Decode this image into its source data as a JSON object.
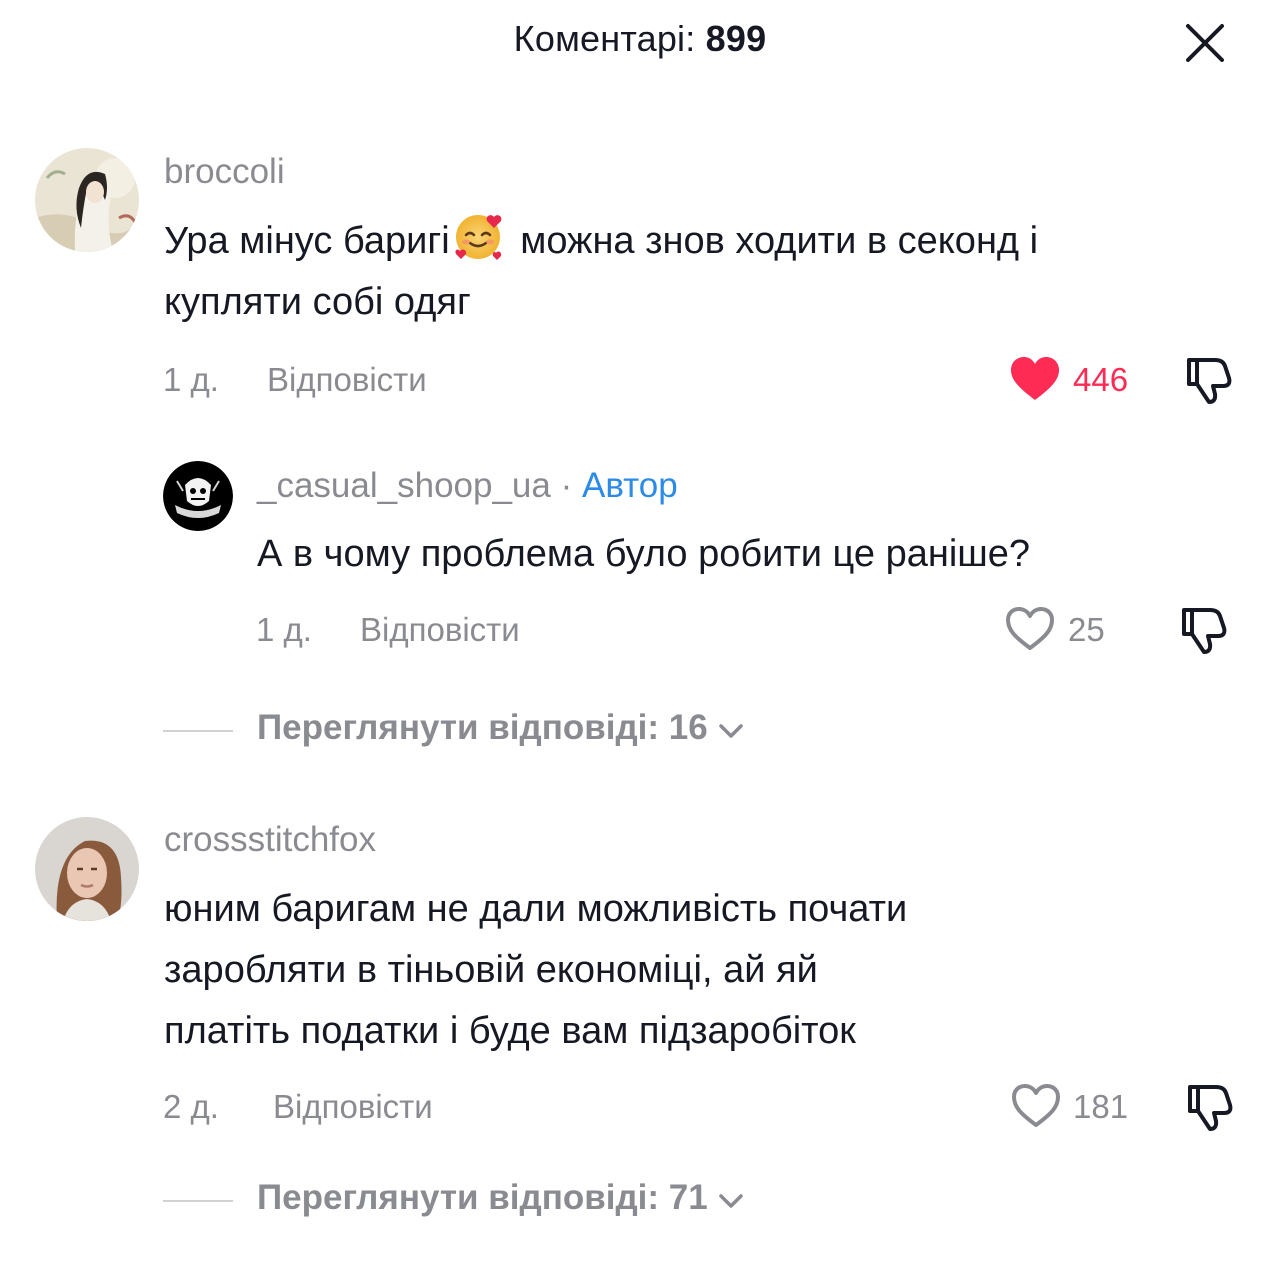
{
  "header": {
    "title_prefix": "Коментарі:",
    "count": "899"
  },
  "comments": [
    {
      "username": "broccoli",
      "text_part1": "Ура мінус баригі",
      "text_emoji": "smiling-face-with-hearts",
      "text_part2": " можна знов ходити в секонд і",
      "text_line2": "купляти собі одяг",
      "time": "1 д.",
      "reply_label": "Відповісти",
      "likes": "446",
      "liked": true,
      "replies": [
        {
          "username": "_casual_shoop_ua",
          "separator": " · ",
          "author_label": "Автор",
          "text": "А в чому проблема було робити це раніше?",
          "time": "1 д.",
          "reply_label": "Відповісти",
          "likes": "25"
        }
      ],
      "view_replies_label": "Переглянути відповіді: 16"
    },
    {
      "username": "crossstitchfox",
      "text_line1": "юним баригам не дали можливість почати",
      "text_line2": "заробляти в тіньовій економіці, ай яй",
      "text_line3": "платіть податки і буде вам підзаробіток",
      "time": "2 д.",
      "reply_label": "Відповісти",
      "likes": "181",
      "view_replies_label": "Переглянути відповіді: 71"
    }
  ],
  "colors": {
    "like_active": "#fe2c55",
    "author_tag": "#2b8be6",
    "secondary_text": "#8a8b91"
  }
}
